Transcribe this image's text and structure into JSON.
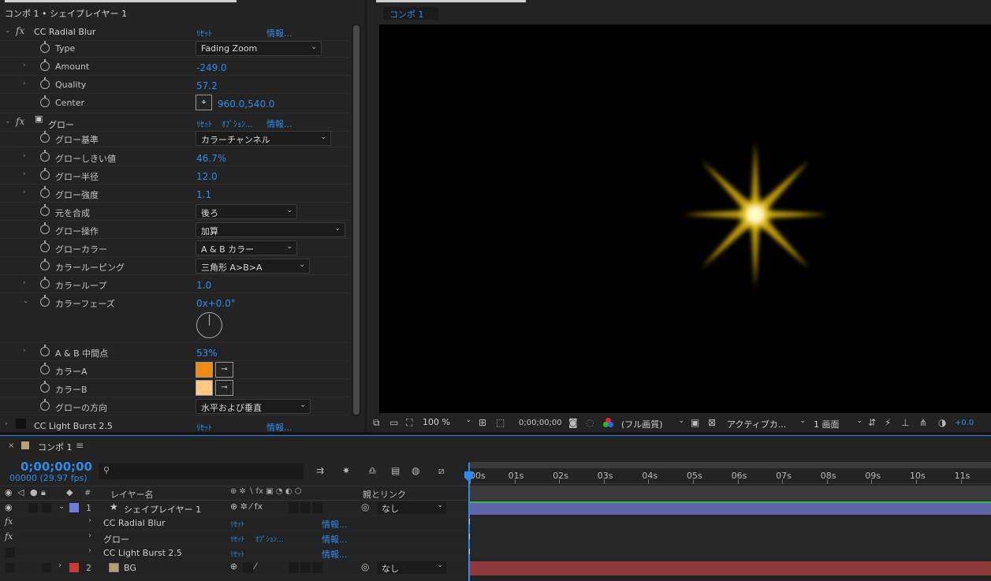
{
  "effect_panel": {
    "title": "コンポ 1 • シェイプレイヤー 1",
    "radial_blur": {
      "name": "CC Radial Blur",
      "reset": "ﾘｾｯﾄ",
      "info": "情報...",
      "type_label": "Type",
      "type_value": "Fading Zoom",
      "amount_label": "Amount",
      "amount_value": "-249.0",
      "quality_label": "Quality",
      "quality_value": "57.2",
      "center_label": "Center",
      "center_value": "960.0,540.0"
    },
    "glow": {
      "name": "グロー",
      "reset": "ﾘｾｯﾄ",
      "options": "ｵﾌﾟｼｮﾝ...",
      "info": "情報...",
      "props": [
        {
          "label": "グロー基準",
          "value": "カラーチャンネル"
        },
        {
          "label": "グローしきい値",
          "value": "46.7%"
        },
        {
          "label": "グロー半径",
          "value": "12.0"
        },
        {
          "label": "グロー強度",
          "value": "1.1"
        },
        {
          "label": "元を合成",
          "value": "後ろ"
        },
        {
          "label": "グロー操作",
          "value": "加算"
        },
        {
          "label": "グローカラー",
          "value": "A & B カラー"
        },
        {
          "label": "カラールーピング",
          "value": "三角形 A>B>A"
        },
        {
          "label": "カラーループ",
          "value": "1.0"
        },
        {
          "label": "カラーフェーズ",
          "value": "0x+0.0°"
        },
        {
          "label": "A & B 中間点",
          "value": "53%"
        },
        {
          "label": "カラーA",
          "value": ""
        },
        {
          "label": "カラーB",
          "value": ""
        },
        {
          "label": "グローの方向",
          "value": "水平および垂直"
        }
      ]
    },
    "light_burst": {
      "name": "CC Light Burst 2.5",
      "reset": "ﾘｾｯﾄ",
      "info": "情報..."
    }
  },
  "viewer": {
    "tab": "コンポ 1",
    "zoom": "100 %",
    "timecode": "0;00;00;00",
    "quality": "(フル画質)",
    "camera": "アクティブカ...",
    "views": "1 画面",
    "exposure": "+0.0"
  },
  "timeline": {
    "tab": "コンポ 1",
    "timecode": "0;00;00;00",
    "frame_fps": "00000 (29.97 fps)",
    "search_placeholder": "",
    "col_hash": "#",
    "col_layer_name": "レイヤー名",
    "col_parent": "親とリンク",
    "ticks": [
      "00s",
      "01s",
      "02s",
      "03s",
      "04s",
      "05s",
      "06s",
      "07s",
      "08s",
      "09s",
      "10s",
      "11s"
    ],
    "layers": [
      {
        "num": "1",
        "name": "シェイプレイヤー 1",
        "parent": "なし"
      },
      {
        "num": "2",
        "name": "BG",
        "parent": "なし"
      }
    ],
    "sub_effects": [
      {
        "name": "CC Radial Blur",
        "reset": "ﾘｾｯﾄ",
        "options": "",
        "info": "情報..."
      },
      {
        "name": "グロー",
        "reset": "ﾘｾｯﾄ",
        "options": "ｵﾌﾟｼｮﾝ...",
        "info": "情報..."
      },
      {
        "name": "CC Light Burst 2.5",
        "reset": "ﾘｾｯﾄ",
        "options": "",
        "info": "情報..."
      }
    ]
  },
  "colors": {
    "accent": "#2d8ceb",
    "color_a": "#f08a12",
    "color_b": "#ffc982",
    "layer1_label": "#6f79d8",
    "layer2_label": "#c73a3a",
    "layer1_bar": "#5f64a8",
    "layer2_bar": "#8e3a3a",
    "star": "#e8c010"
  }
}
